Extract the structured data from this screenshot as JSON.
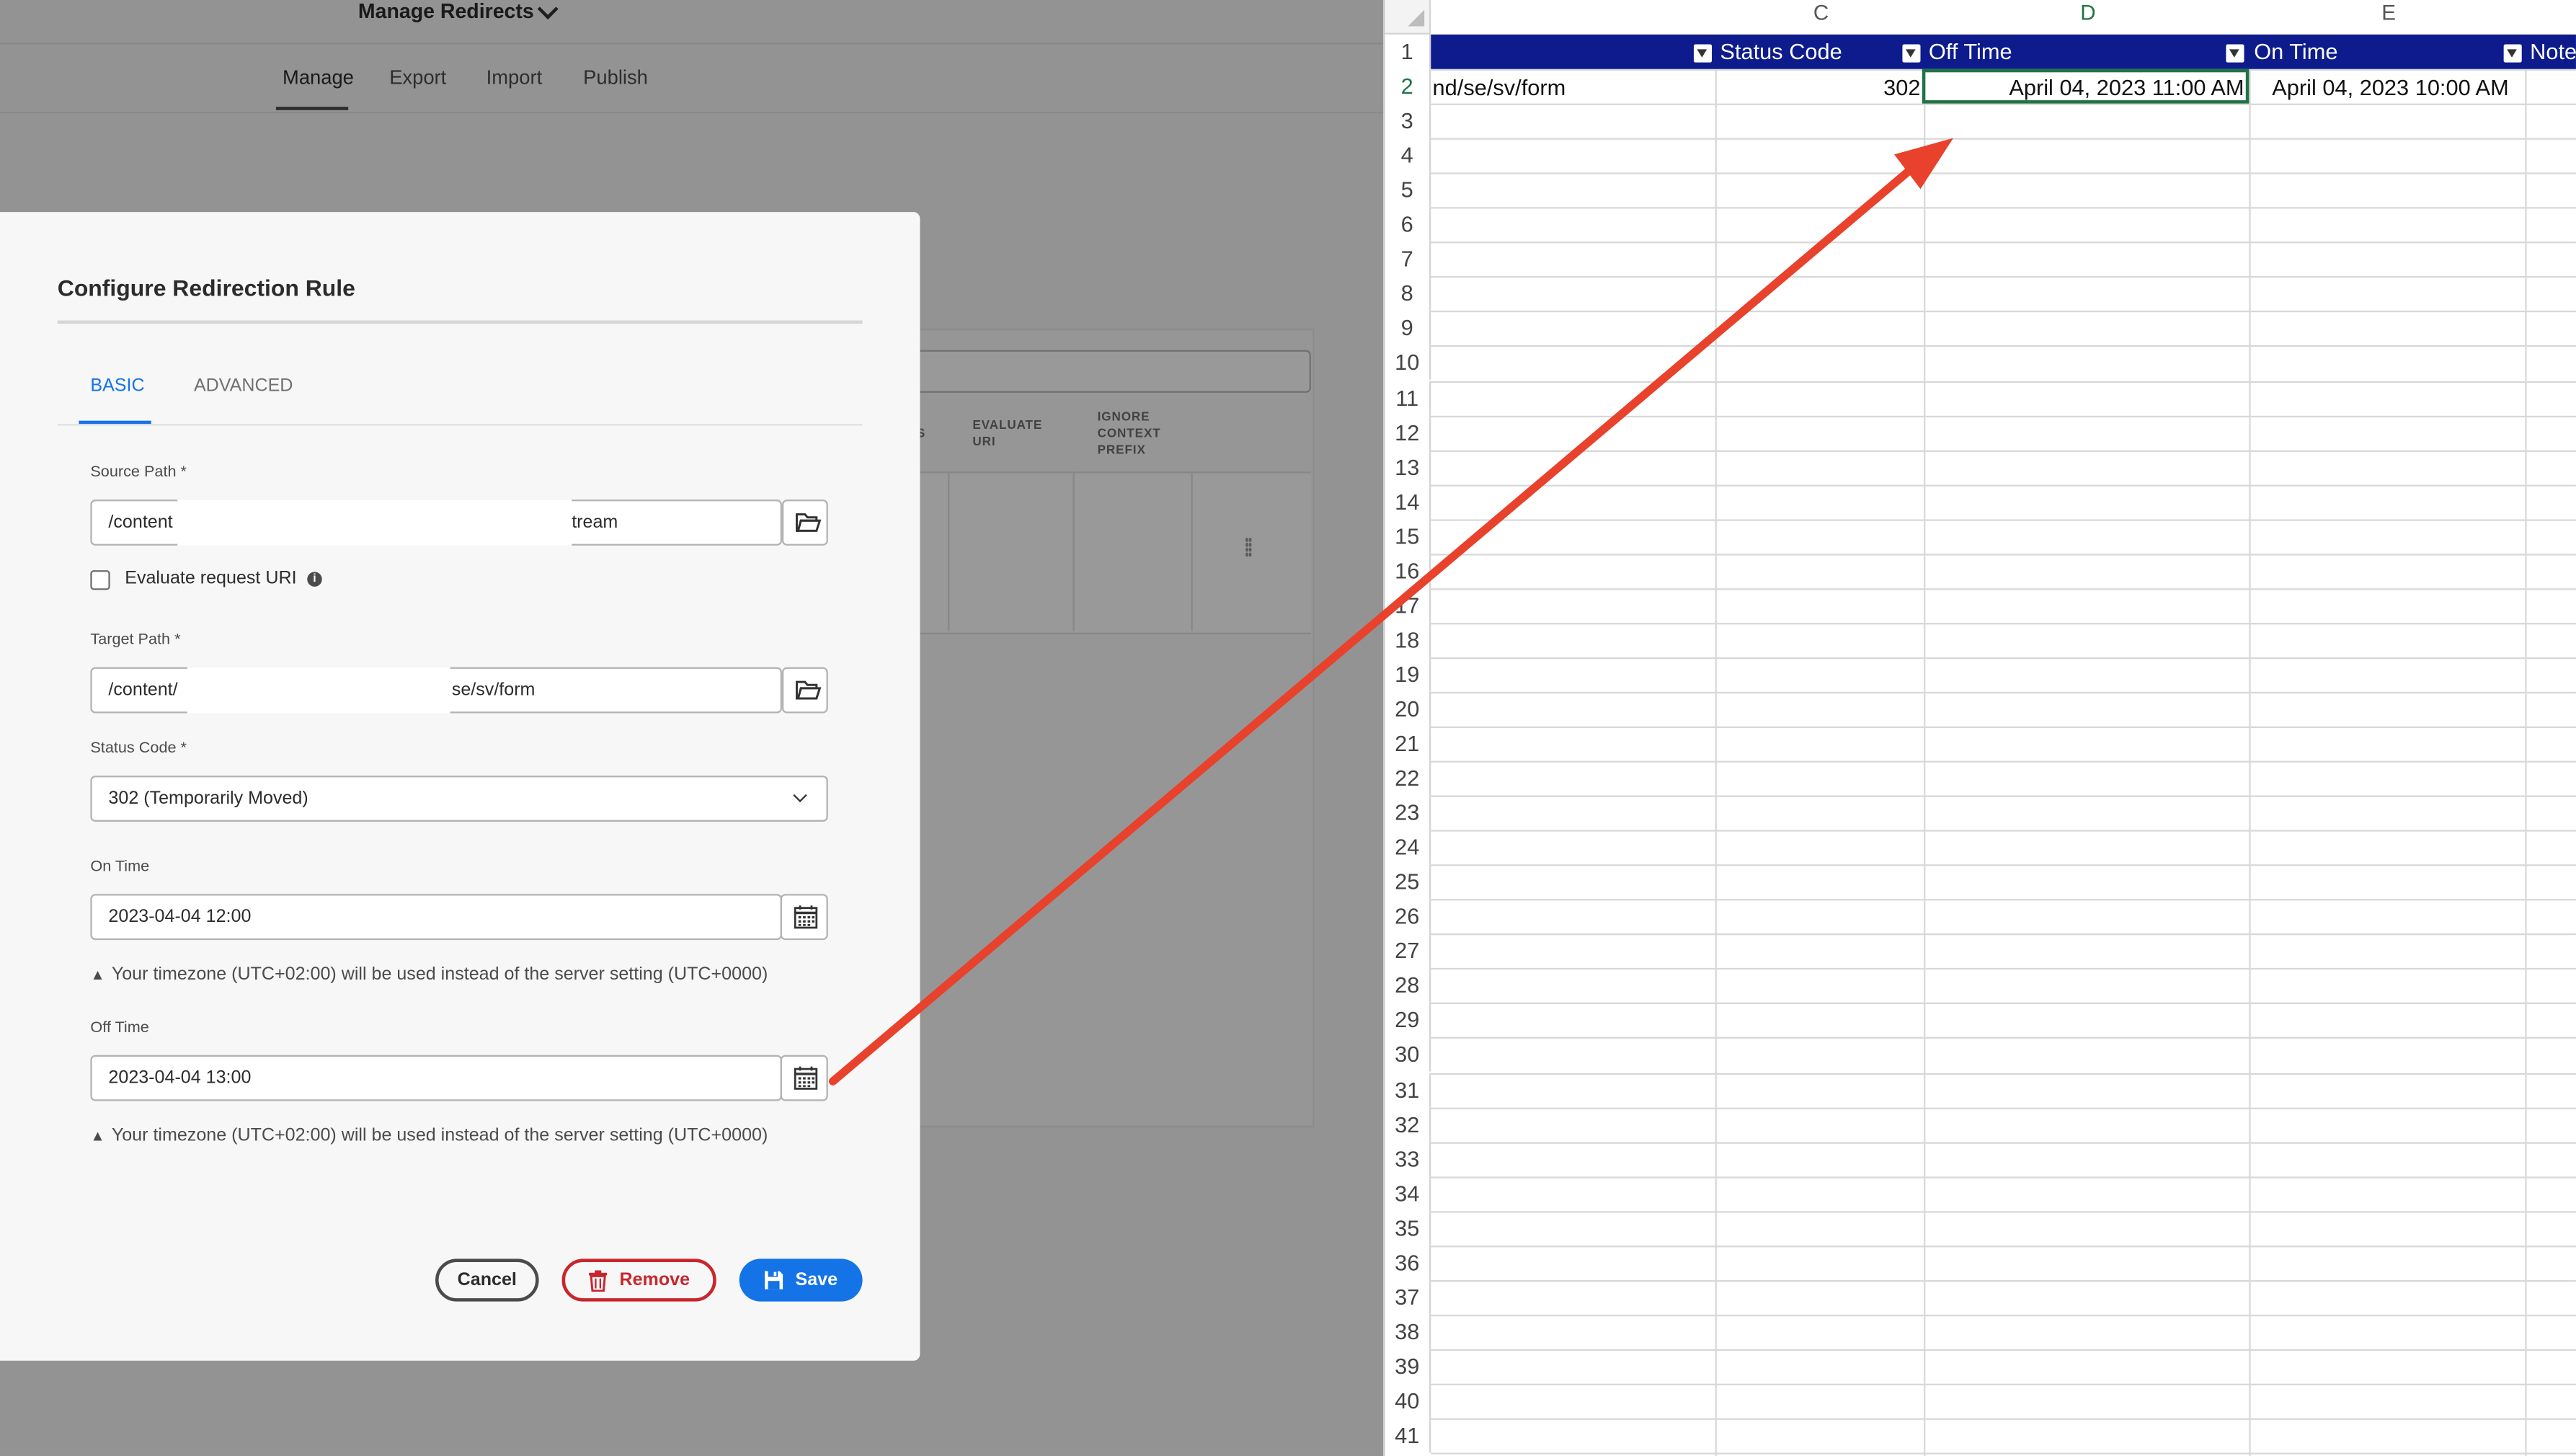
{
  "aem": {
    "app_title": "Manage Redirects",
    "tabs": [
      "Manage",
      "Export",
      "Import",
      "Publish"
    ],
    "table_headers": {
      "partial": "S",
      "evaluate_uri": "EVALUATE URI",
      "ignore_context_prefix": "IGNORE CONTEXT PREFIX"
    }
  },
  "dialog": {
    "title": "Configure Redirection Rule",
    "tabs": {
      "basic": "BASIC",
      "advanced": "ADVANCED"
    },
    "source_path": {
      "label": "Source Path *",
      "value_start": "/content",
      "value_end": "tream"
    },
    "evaluate_request_uri": {
      "label": "Evaluate request URI",
      "checked": false
    },
    "target_path": {
      "label": "Target Path *",
      "value_start": "/content/",
      "value_end": "se/sv/form"
    },
    "status_code": {
      "label": "Status Code *",
      "value": "302 (Temporarily Moved)"
    },
    "on_time": {
      "label": "On Time",
      "value": "2023-04-04 12:00"
    },
    "off_time": {
      "label": "Off Time",
      "value": "2023-04-04 13:00"
    },
    "timezone_note": "Your timezone (UTC+02:00) will be used instead of the server setting (UTC+0000)",
    "buttons": {
      "cancel": "Cancel",
      "remove": "Remove",
      "save": "Save"
    }
  },
  "sheet": {
    "columns": [
      "C",
      "D",
      "E"
    ],
    "active_column": "D",
    "header_row": {
      "b": "",
      "c": "Status Code",
      "d": "Off Time",
      "e": "On Time",
      "f": "Note"
    },
    "row2": {
      "b": "nd/se/sv/form",
      "c": "302",
      "d": "April 04, 2023 11:00 AM",
      "e": "April 04, 2023 10:00 AM"
    },
    "row_numbers": [
      "1",
      "2",
      "3",
      "4",
      "5",
      "6",
      "7",
      "8",
      "9",
      "10",
      "11",
      "12",
      "13",
      "14",
      "15",
      "16",
      "17",
      "18",
      "19",
      "20",
      "21",
      "22",
      "23",
      "24",
      "25",
      "26",
      "27",
      "28",
      "29",
      "30",
      "31",
      "32",
      "33",
      "34",
      "35",
      "36",
      "37",
      "38",
      "39",
      "40",
      "41"
    ],
    "active_row": "2"
  },
  "colors": {
    "accent_blue": "#1473e6",
    "remove_red": "#c9252d",
    "table_header_navy": "#0d1b8c",
    "selection_green": "#217346",
    "annotation_arrow": "#e8412c"
  }
}
